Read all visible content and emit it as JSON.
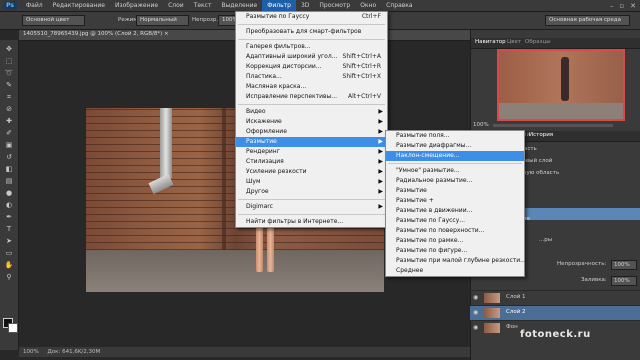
{
  "menubar": {
    "logo": "Ps",
    "items": [
      "Файл",
      "Редактирование",
      "Изображение",
      "Слои",
      "Текст",
      "Выделение",
      "Фильтр",
      "3D",
      "Просмотр",
      "Окно",
      "Справка"
    ],
    "active": "Фильтр",
    "window_controls": [
      "–",
      "▫",
      "✕"
    ]
  },
  "options_bar": {
    "preset": "Основной цвет",
    "mode_label": "Режим:",
    "mode_value": "Нормальный",
    "opacity_label": "Непрозр.:",
    "opacity_value": "100%",
    "workspace": "Основная рабочая среда"
  },
  "document": {
    "tab_title": "1405510_78965439.jpg @ 100% (Слой 2, RGB/8*) ×",
    "status_zoom": "100%",
    "status_doc": "Док: 641,6K/2,30M"
  },
  "filter_menu": {
    "items": [
      {
        "label": "Размытие по Гауссу",
        "shortcut": "Ctrl+F"
      },
      {
        "sep": true
      },
      {
        "label": "Преобразовать для смарт-фильтров"
      },
      {
        "sep": true
      },
      {
        "label": "Галерея фильтров..."
      },
      {
        "label": "Адаптивный широкий угол...",
        "shortcut": "Shift+Ctrl+A"
      },
      {
        "label": "Коррекция дисторсии...",
        "shortcut": "Shift+Ctrl+R"
      },
      {
        "label": "Пластика...",
        "shortcut": "Shift+Ctrl+X"
      },
      {
        "label": "Масляная краска..."
      },
      {
        "label": "Исправление перспективы...",
        "shortcut": "Alt+Ctrl+V"
      },
      {
        "sep": true
      },
      {
        "label": "Видео",
        "arrow": true
      },
      {
        "label": "Искажение",
        "arrow": true
      },
      {
        "label": "Оформление",
        "arrow": true
      },
      {
        "label": "Размытие",
        "arrow": true,
        "highlight": true
      },
      {
        "label": "Рендеринг",
        "arrow": true
      },
      {
        "label": "Стилизация",
        "arrow": true
      },
      {
        "label": "Усиление резкости",
        "arrow": true
      },
      {
        "label": "Шум",
        "arrow": true
      },
      {
        "label": "Другое",
        "arrow": true
      },
      {
        "sep": true
      },
      {
        "label": "Digimarc",
        "arrow": true
      },
      {
        "sep": true
      },
      {
        "label": "Найти фильтры в Интернете..."
      }
    ]
  },
  "blur_submenu": {
    "items": [
      {
        "label": "Размытие поля..."
      },
      {
        "label": "Размытие диафрагмы..."
      },
      {
        "label": "Наклон-смещение...",
        "highlight": true
      },
      {
        "sep": true
      },
      {
        "label": "\"Умное\" размытие..."
      },
      {
        "label": "Радиальное размытие..."
      },
      {
        "label": "Размытие"
      },
      {
        "label": "Размытие +"
      },
      {
        "label": "Размытие в движении..."
      },
      {
        "label": "Размытие по Гауссу..."
      },
      {
        "label": "Размытие по поверхности..."
      },
      {
        "label": "Размытие по рамке..."
      },
      {
        "label": "Размытие по фигуре..."
      },
      {
        "label": "Размытие при малой глубине резкости..."
      },
      {
        "label": "Среднее"
      }
    ]
  },
  "panels": {
    "navigator_tabs": [
      "Навигатор",
      "Цвет",
      "Образцы"
    ],
    "navigator_zoom": "100%",
    "history_tabs": [
      "Операции",
      "История"
    ],
    "history_items": [
      "...ая область",
      "...в на новый слой",
      "...деленную область",
      "...ие",
      "...деление"
    ],
    "layers_label": "...ры",
    "opacity_label": "Непрозрачность:",
    "opacity_value": "100%",
    "fill_label": "Заливка:",
    "fill_value": "100%",
    "layers": [
      "Слой 1",
      "Слой 2",
      "Фон"
    ]
  },
  "watermark": "fotoneck.ru"
}
